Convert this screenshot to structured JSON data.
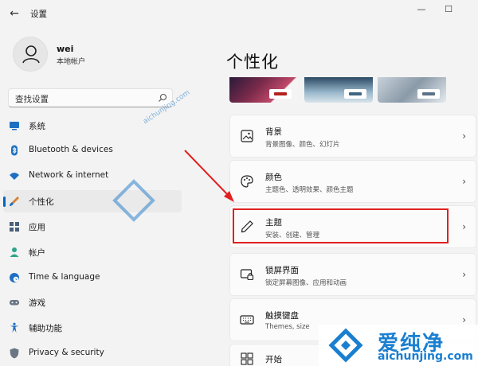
{
  "window": {
    "title": "设置",
    "back_glyph": "←",
    "minimize_glyph": "—",
    "maximize_glyph": "☐"
  },
  "profile": {
    "name": "wei",
    "account_type": "本地帐户"
  },
  "search": {
    "placeholder": "查找设置"
  },
  "sidebar": {
    "items": [
      {
        "label": "系统",
        "icon": "monitor-icon",
        "active": false
      },
      {
        "label": "Bluetooth & devices",
        "icon": "bluetooth-icon",
        "active": false
      },
      {
        "label": "Network & internet",
        "icon": "wifi-icon",
        "active": false
      },
      {
        "label": "个性化",
        "icon": "brush-icon",
        "active": true
      },
      {
        "label": "应用",
        "icon": "apps-icon",
        "active": false
      },
      {
        "label": "帐户",
        "icon": "person-icon",
        "active": false
      },
      {
        "label": "Time & language",
        "icon": "globe-clock-icon",
        "active": false
      },
      {
        "label": "游戏",
        "icon": "gamepad-icon",
        "active": false
      },
      {
        "label": "辅助功能",
        "icon": "accessibility-icon",
        "active": false
      },
      {
        "label": "Privacy & security",
        "icon": "shield-icon",
        "active": false
      }
    ]
  },
  "main": {
    "title": "个性化",
    "cards": [
      {
        "title": "背景",
        "subtitle": "背景图像、颜色、幻灯片",
        "icon": "image-icon"
      },
      {
        "title": "颜色",
        "subtitle": "主题色、透明效果、颜色主题",
        "icon": "palette-icon"
      },
      {
        "title": "主题",
        "subtitle": "安装、创建、管理",
        "icon": "pen-icon"
      },
      {
        "title": "锁屏界面",
        "subtitle": "锁定屏幕图像、应用和动画",
        "icon": "lockscreen-icon"
      },
      {
        "title": "触摸键盘",
        "subtitle": "Themes, size",
        "icon": "keyboard-icon"
      },
      {
        "title": "开始",
        "subtitle": "",
        "icon": "start-icon"
      }
    ],
    "chevron": "›"
  },
  "watermark": {
    "text_cn": "爱纯净",
    "url": "aichunjing.com"
  },
  "colors": {
    "accent": "#0067c0",
    "highlight": "#e0201f",
    "background": "#f3f3f3",
    "card": "#fbfbfb",
    "watermark": "#1a7fd1"
  }
}
